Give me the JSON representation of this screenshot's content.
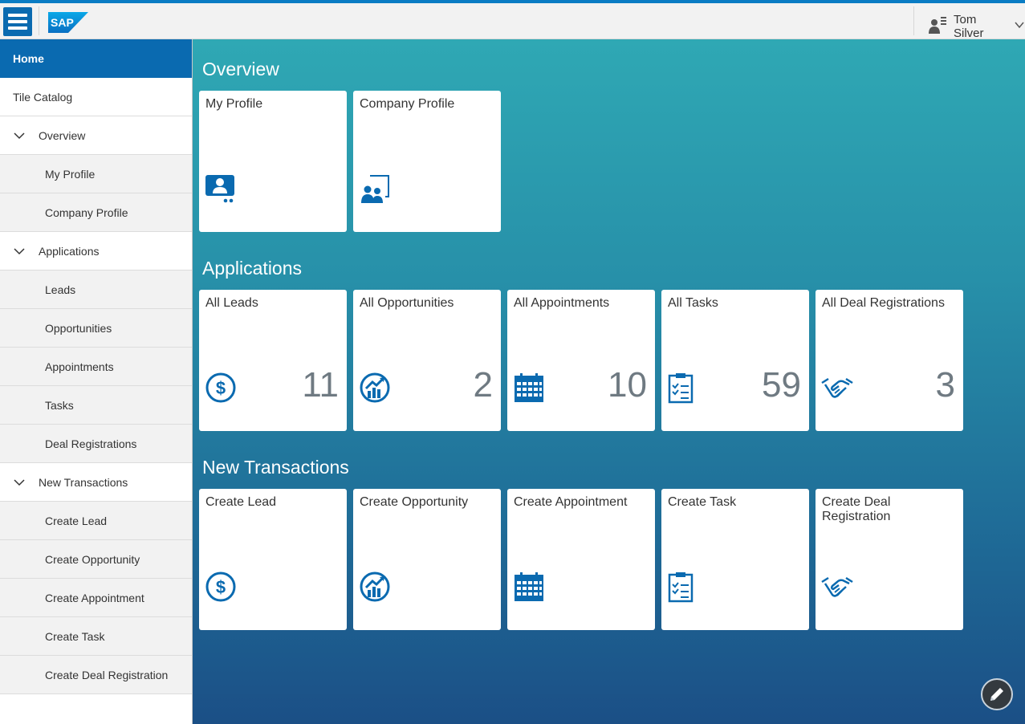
{
  "header": {
    "logo_text": "SAP",
    "user_name": "Tom Silver",
    "colors": {
      "brand": "#0a6ab0",
      "accent_bar": "#0a7cc4"
    }
  },
  "sidebar": {
    "home": "Home",
    "catalog": "Tile Catalog",
    "groups": [
      {
        "label": "Overview",
        "items": [
          "My Profile",
          "Company Profile"
        ]
      },
      {
        "label": "Applications",
        "items": [
          "Leads",
          "Opportunities",
          "Appointments",
          "Tasks",
          "Deal Registrations"
        ]
      },
      {
        "label": "New Transactions",
        "items": [
          "Create Lead",
          "Create Opportunity",
          "Create Appointment",
          "Create Task",
          "Create Deal Registration"
        ]
      }
    ]
  },
  "sections": {
    "overview": {
      "title": "Overview",
      "tiles": [
        {
          "title": "My Profile",
          "icon": "profile-icon"
        },
        {
          "title": "Company Profile",
          "icon": "company-icon"
        }
      ]
    },
    "applications": {
      "title": "Applications",
      "tiles": [
        {
          "title": "All Leads",
          "count": "11",
          "icon": "dollar-icon"
        },
        {
          "title": "All Opportunities",
          "count": "2",
          "icon": "opportunity-icon"
        },
        {
          "title": "All Appointments",
          "count": "10",
          "icon": "calendar-icon"
        },
        {
          "title": "All Tasks",
          "count": "59",
          "icon": "task-icon"
        },
        {
          "title": "All Deal Registrations",
          "count": "3",
          "icon": "handshake-icon"
        }
      ]
    },
    "transactions": {
      "title": "New Transactions",
      "tiles": [
        {
          "title": "Create Lead",
          "icon": "dollar-icon"
        },
        {
          "title": "Create Opportunity",
          "icon": "opportunity-icon"
        },
        {
          "title": "Create Appointment",
          "icon": "calendar-icon"
        },
        {
          "title": "Create Task",
          "icon": "task-icon"
        },
        {
          "title": "Create Deal Registration",
          "icon": "handshake-icon"
        }
      ]
    }
  },
  "fab_icon": "pencil-icon"
}
